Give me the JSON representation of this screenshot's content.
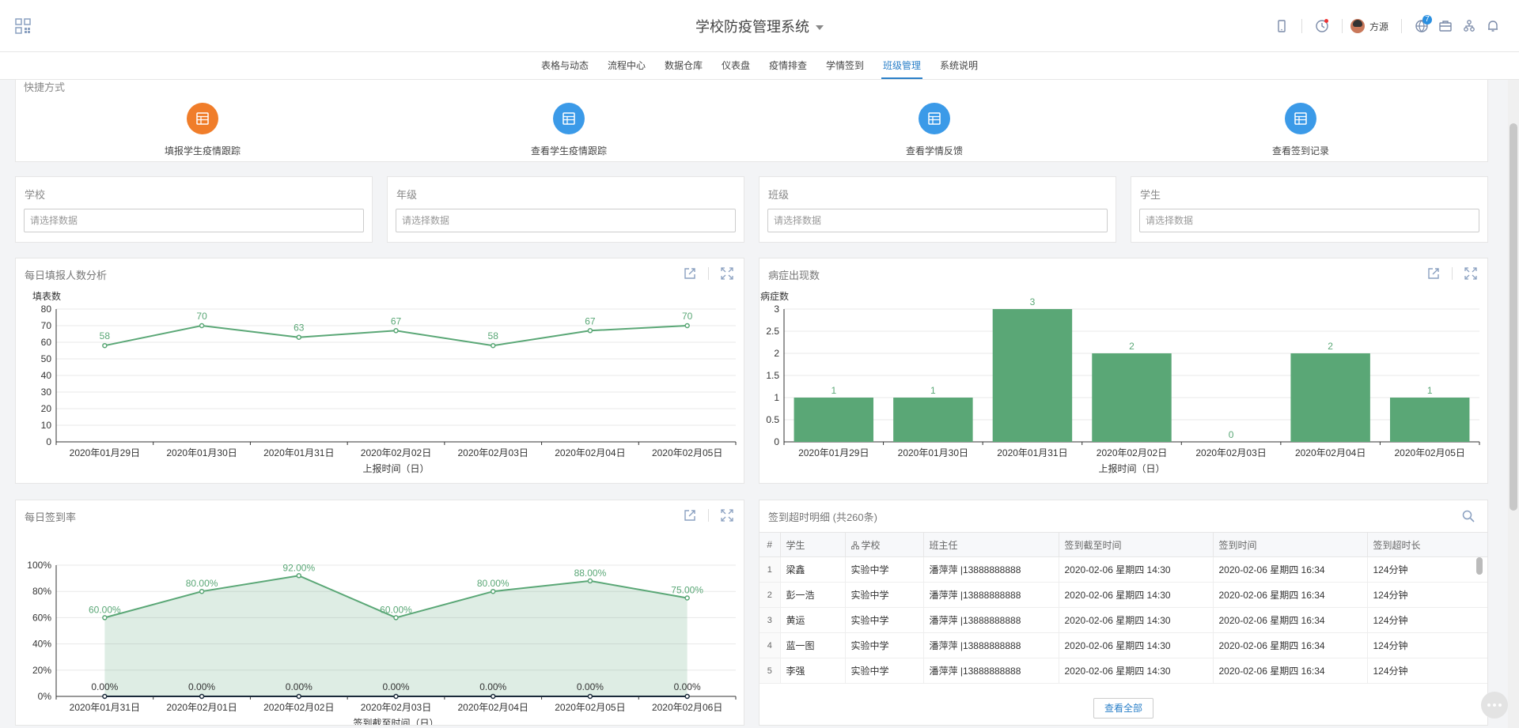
{
  "header": {
    "title": "学校防疫管理系统",
    "user_name": "方源",
    "notification_count": "7"
  },
  "nav": {
    "items": [
      "表格与动态",
      "流程中心",
      "数据仓库",
      "仪表盘",
      "疫情排查",
      "学情签到",
      "班级管理",
      "系统说明"
    ],
    "active_index": 6
  },
  "quick": {
    "title": "快捷方式",
    "items": [
      {
        "label": "填报学生疫情跟踪",
        "color": "#f07d2a"
      },
      {
        "label": "查看学生疫情跟踪",
        "color": "#3b9ae8"
      },
      {
        "label": "查看学情反馈",
        "color": "#3b9ae8"
      },
      {
        "label": "查看签到记录",
        "color": "#3b9ae8"
      }
    ]
  },
  "filters": [
    {
      "label": "学校",
      "placeholder": "请选择数据"
    },
    {
      "label": "年级",
      "placeholder": "请选择数据"
    },
    {
      "label": "班级",
      "placeholder": "请选择数据"
    },
    {
      "label": "学生",
      "placeholder": "请选择数据"
    }
  ],
  "chart_data": [
    {
      "type": "line",
      "title": "每日填报人数分析",
      "ylabel": "填表数",
      "xlabel": "上报时间（日）",
      "categories": [
        "2020年01月29日",
        "2020年01月30日",
        "2020年01月31日",
        "2020年02月02日",
        "2020年02月03日",
        "2020年02月04日",
        "2020年02月05日"
      ],
      "values": [
        58,
        70,
        63,
        67,
        58,
        67,
        70
      ],
      "ylim": [
        0,
        80
      ],
      "yticks": [
        0,
        10,
        20,
        30,
        40,
        50,
        60,
        70,
        80
      ],
      "color": "#5aa776"
    },
    {
      "type": "bar",
      "title": "病症出现数",
      "ylabel": "病症数",
      "xlabel": "上报时间（日）",
      "categories": [
        "2020年01月29日",
        "2020年01月30日",
        "2020年01月31日",
        "2020年02月02日",
        "2020年02月03日",
        "2020年02月04日",
        "2020年02月05日"
      ],
      "values": [
        1,
        1,
        3,
        2,
        0,
        2,
        1
      ],
      "ylim": [
        0,
        3
      ],
      "yticks": [
        "0",
        "0.5",
        "1",
        "1.5",
        "2",
        "2.5",
        "3"
      ],
      "color": "#5aa776"
    },
    {
      "type": "area",
      "title": "每日签到率",
      "xlabel": "签到截至时间（日）",
      "categories": [
        "2020年01月31日",
        "2020年02月01日",
        "2020年02月02日",
        "2020年02月03日",
        "2020年02月04日",
        "2020年02月05日",
        "2020年02月06日"
      ],
      "series": [
        {
          "values": [
            60,
            80,
            92,
            60,
            80,
            88,
            75
          ],
          "labels": [
            "60.00%",
            "80.00%",
            "92.00%",
            "60.00%",
            "80.00%",
            "88.00%",
            "75.00%"
          ]
        },
        {
          "values": [
            0,
            0,
            0,
            0,
            0,
            0,
            0
          ],
          "labels": [
            "0.00%",
            "0.00%",
            "0.00%",
            "0.00%",
            "0.00%",
            "0.00%",
            "0.00%"
          ]
        }
      ],
      "ylim": [
        0,
        100
      ],
      "yticks": [
        "0%",
        "20%",
        "40%",
        "60%",
        "80%",
        "100%"
      ],
      "color": "#5aa776"
    }
  ],
  "table": {
    "title": "签到超时明细 (共260条)",
    "columns": [
      "#",
      "学生",
      "学校",
      "班主任",
      "签到截至时间",
      "签到时间",
      "签到超时长"
    ],
    "rows": [
      [
        "1",
        "梁鑫",
        "实验中学",
        "潘萍萍 |13888888888",
        "2020-02-06 星期四 14:30",
        "2020-02-06 星期四 16:34",
        "124分钟"
      ],
      [
        "2",
        "彭一浩",
        "实验中学",
        "潘萍萍 |13888888888",
        "2020-02-06 星期四 14:30",
        "2020-02-06 星期四 16:34",
        "124分钟"
      ],
      [
        "3",
        "黄运",
        "实验中学",
        "潘萍萍 |13888888888",
        "2020-02-06 星期四 14:30",
        "2020-02-06 星期四 16:34",
        "124分钟"
      ],
      [
        "4",
        "蓝一图",
        "实验中学",
        "潘萍萍 |13888888888",
        "2020-02-06 星期四 14:30",
        "2020-02-06 星期四 16:34",
        "124分钟"
      ],
      [
        "5",
        "李强",
        "实验中学",
        "潘萍萍 |13888888888",
        "2020-02-06 星期四 14:30",
        "2020-02-06 星期四 16:34",
        "124分钟"
      ]
    ],
    "view_all_label": "查看全部"
  }
}
